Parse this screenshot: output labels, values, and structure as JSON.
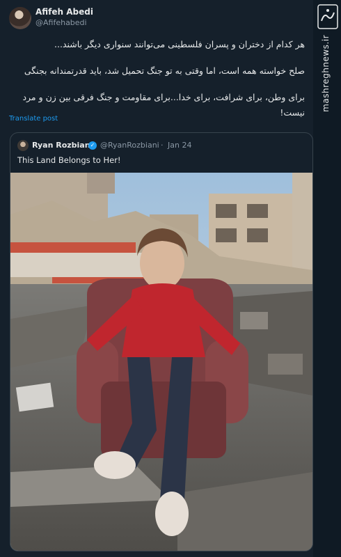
{
  "author": {
    "name": "Afifeh Abedi",
    "handle": "@Afifehabedi"
  },
  "body_lines": [
    "هر کدام از دختران و پسران فلسطینی می‌توانند سنواری دیگر باشند...",
    "صلح خواسته همه است، اما وقتی به تو جنگ تحمیل شد، باید قدرتمندانه بجنگی",
    "برای وطن، برای شرافت، برای خدا...برای مقاومت و جنگ فرقی بین زن و مرد",
    "نیست!"
  ],
  "translate_label": "Translate post",
  "quote": {
    "name": "Ryan Rozbiani",
    "handle": "@RyanRozbiani",
    "dot": "·",
    "date": "Jan 24",
    "text": "This Land Belongs to Her!"
  },
  "watermark": {
    "site": "mashreghnews.ir",
    "logo_text": "مشرق"
  },
  "colors": {
    "background": "#15202b",
    "link": "#1d9bf0",
    "verified": "#1d9bf0"
  }
}
